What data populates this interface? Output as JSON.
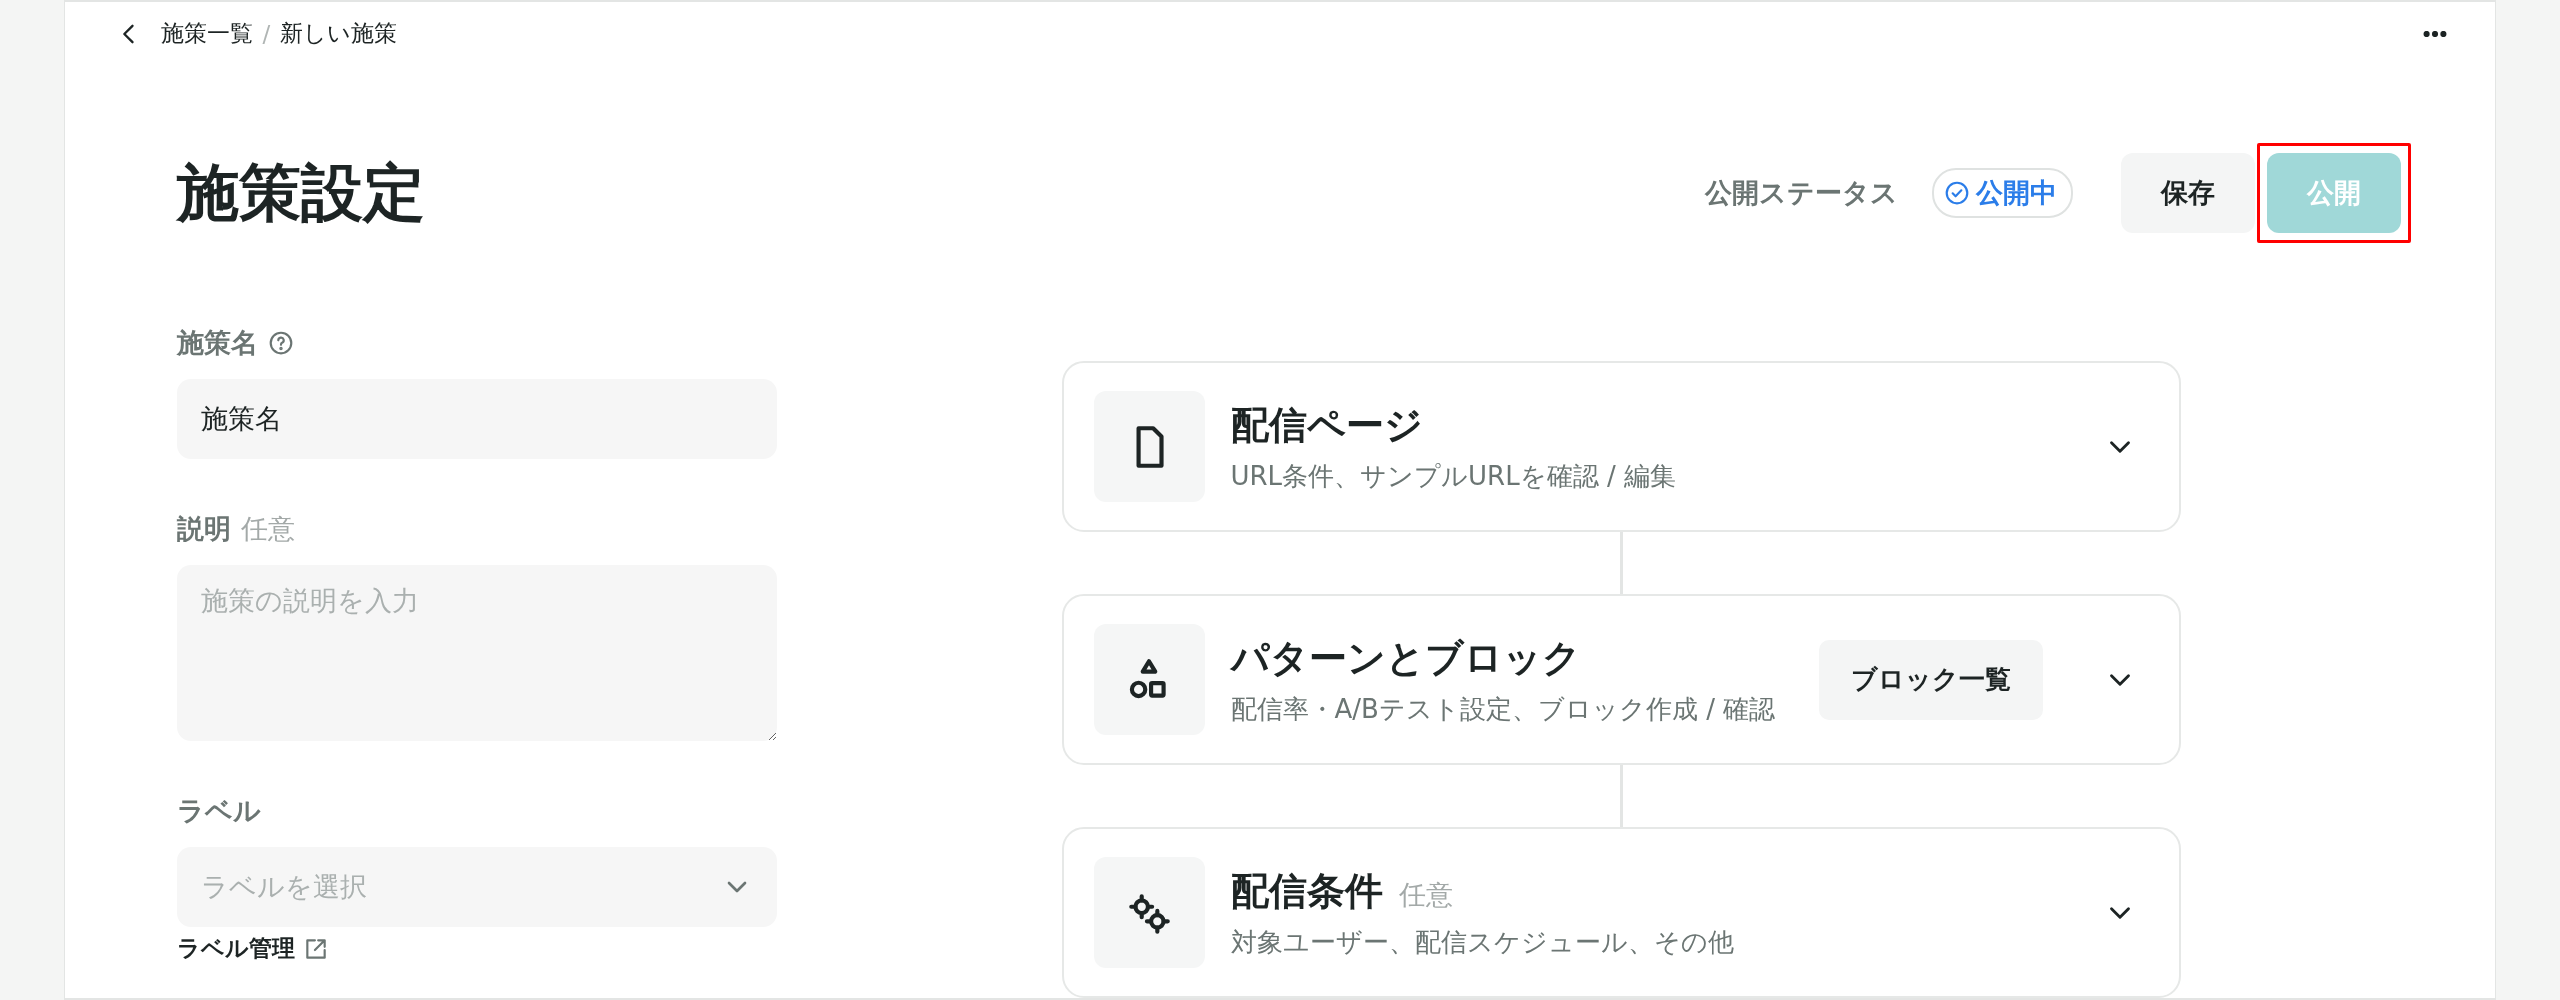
{
  "breadcrumb": {
    "items": [
      "施策一覧",
      "新しい施策"
    ],
    "separator": "/"
  },
  "page_title": "施策設定",
  "status": {
    "label": "公開ステータス",
    "badge": "公開中"
  },
  "buttons": [
    {
      "label": "保存",
      "kind": "secondary",
      "disabled": false,
      "highlighted": false
    },
    {
      "label": "公開",
      "kind": "primary",
      "disabled": true,
      "highlighted": true
    }
  ],
  "form": [
    {
      "kind": "text",
      "label": "施策名",
      "help": true,
      "value": "施策名"
    },
    {
      "kind": "textarea",
      "label": "説明",
      "optional": "任意",
      "placeholder": "施策の説明を入力"
    },
    {
      "kind": "select",
      "label": "ラベル",
      "placeholder": "ラベルを選択",
      "link": "ラベル管理"
    }
  ],
  "sections": [
    {
      "kind": "page",
      "title": "配信ページ",
      "subtitle": "URL条件、サンプルURLを確認 / 編集",
      "expanded": false
    },
    {
      "kind": "blocks",
      "title": "パターンとブロック",
      "subtitle": "配信率・A/Bテスト設定、ブロック作成 / 確認",
      "action": "ブロック一覧",
      "expanded": false
    },
    {
      "kind": "conditions",
      "title": "配信条件",
      "optional": "任意",
      "subtitle": "対象ユーザー、配信スケジュール、その他",
      "expanded": false
    }
  ]
}
